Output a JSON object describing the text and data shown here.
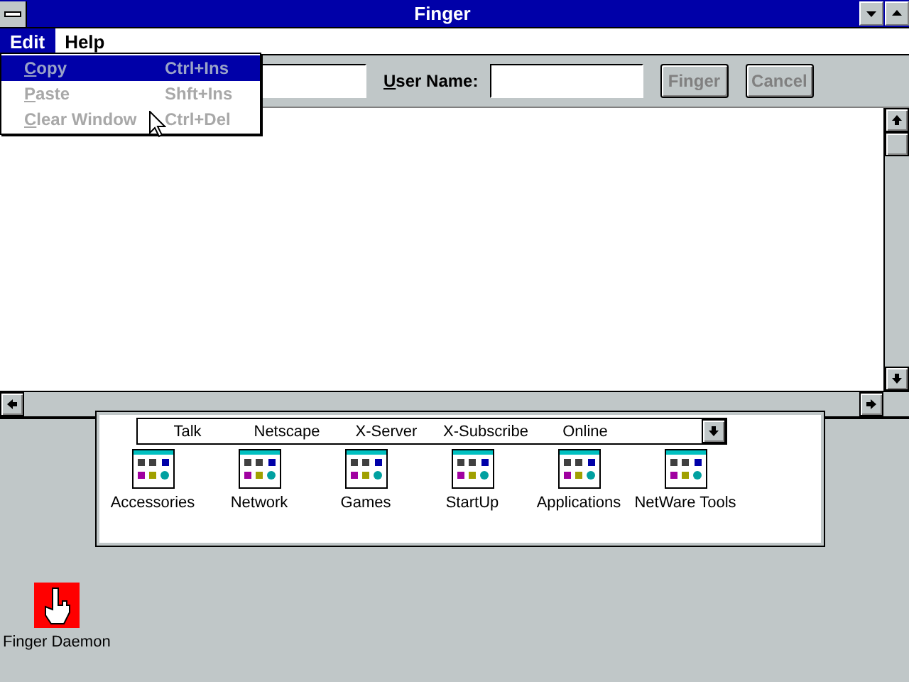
{
  "window": {
    "title": "Finger"
  },
  "menu_bar": [
    {
      "label": "Edit",
      "selected": true
    },
    {
      "label": "Help",
      "selected": false
    }
  ],
  "edit_menu": [
    {
      "label": "Copy",
      "shortcut": "Ctrl+Ins",
      "selected": true,
      "disabled": true
    },
    {
      "label": "Paste",
      "shortcut": "Shft+Ins",
      "selected": false,
      "disabled": true
    },
    {
      "label": "Clear Window",
      "shortcut": "Ctrl+Del",
      "selected": false,
      "disabled": true
    }
  ],
  "toolbar": {
    "user_name_label": "User Name:",
    "buttons": [
      {
        "label": "Finger",
        "disabled": true
      },
      {
        "label": "Cancel",
        "disabled": true
      }
    ]
  },
  "group_window": {
    "list_items": [
      "Talk",
      "Netscape",
      "X-Server",
      "X-Subscribe",
      "Online"
    ],
    "groups": [
      "Accessories",
      "Network",
      "Games",
      "StartUp",
      "Applications",
      "NetWare Tools"
    ]
  },
  "desktop_icons": [
    {
      "label": "Finger Daemon"
    }
  ]
}
